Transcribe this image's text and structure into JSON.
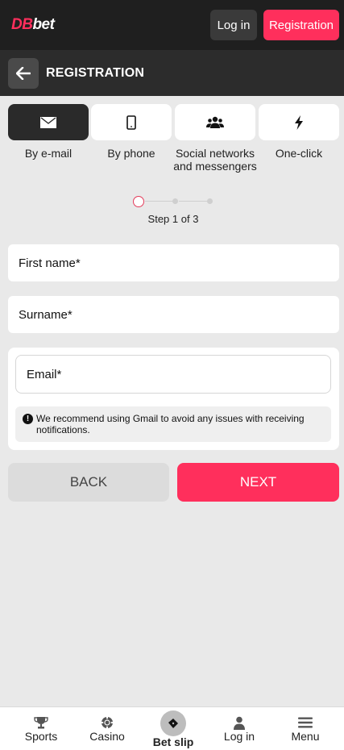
{
  "header": {
    "logo_part1": "DB",
    "logo_part2": "bet",
    "login_label": "Log in",
    "registration_label": "Registration"
  },
  "title_bar": {
    "title": "REGISTRATION"
  },
  "methods": [
    {
      "label": "By e-mail",
      "icon": "envelope-icon",
      "active": true
    },
    {
      "label": "By phone",
      "icon": "phone-icon",
      "active": false
    },
    {
      "label": "Social networks and messengers",
      "icon": "users-icon",
      "active": false
    },
    {
      "label": "One-click",
      "icon": "lightning-icon",
      "active": false
    }
  ],
  "stepper": {
    "label": "Step 1 of 3",
    "current": 1,
    "total": 3
  },
  "form": {
    "first_name_placeholder": "First name*",
    "surname_placeholder": "Surname*",
    "email_placeholder": "Email*",
    "notice": "We recommend using Gmail to avoid any issues with receiving notifications."
  },
  "actions": {
    "back_label": "BACK",
    "next_label": "NEXT"
  },
  "bottom_nav": [
    {
      "label": "Sports",
      "icon": "trophy-icon"
    },
    {
      "label": "Casino",
      "icon": "casino-chip-icon"
    },
    {
      "label": "Bet slip",
      "icon": "ticket-icon"
    },
    {
      "label": "Log in",
      "icon": "user-icon"
    },
    {
      "label": "Menu",
      "icon": "hamburger-icon"
    }
  ],
  "colors": {
    "accent": "#ff2f5c",
    "header_bg": "#1f1f1f",
    "titlebar_bg": "#2c2c2c",
    "page_bg": "#e9e9e9"
  }
}
